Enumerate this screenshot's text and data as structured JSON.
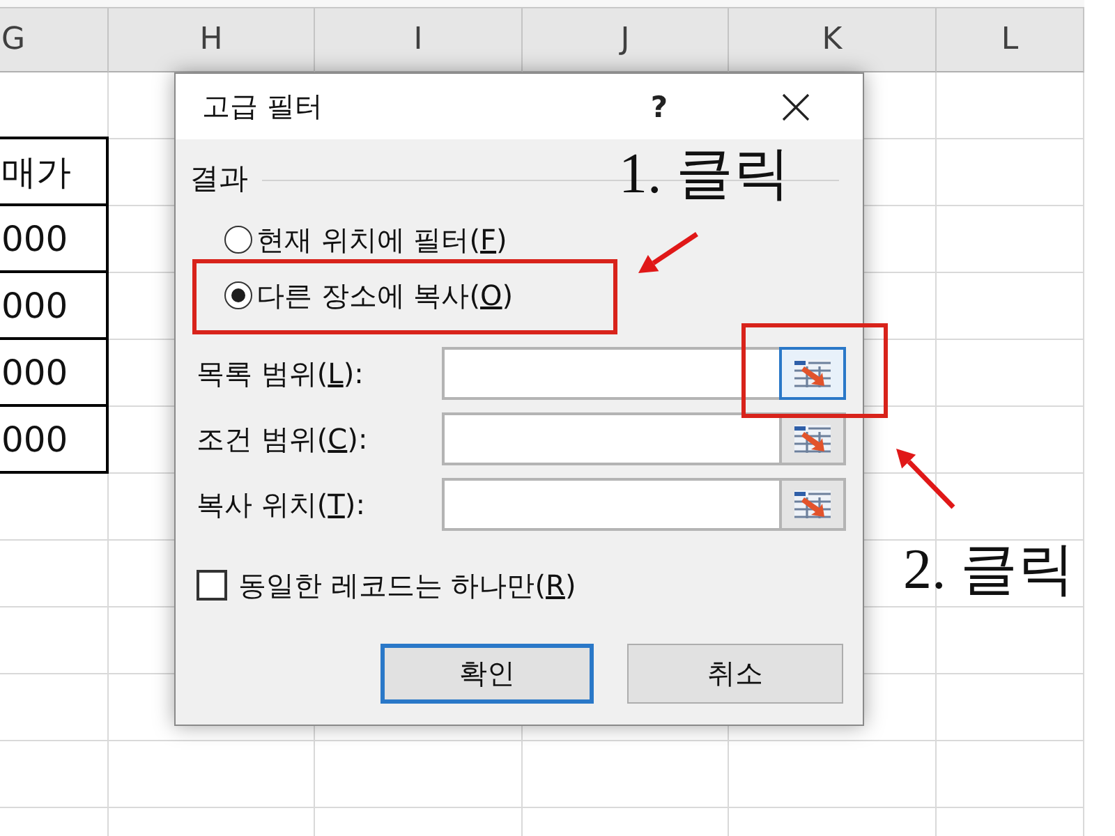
{
  "sheet": {
    "columns": [
      "G",
      "H",
      "I",
      "J",
      "K",
      "L"
    ],
    "cells": [
      "매가",
      "000",
      "000",
      "000",
      "000"
    ]
  },
  "dialog": {
    "title": "고급 필터",
    "help": "?",
    "group_label": "결과",
    "options": [
      {
        "before": "현재 위치에 필터(",
        "key": "F",
        "after": ")",
        "selected": false
      },
      {
        "before": "다른 장소에 복사(",
        "key": "O",
        "after": ")",
        "selected": true
      }
    ],
    "ranges": [
      {
        "before": "목록 범위(",
        "key": "L",
        "after": "):",
        "focused": true
      },
      {
        "before": "조건 범위(",
        "key": "C",
        "after": "):",
        "focused": false
      },
      {
        "before": "복사 위치(",
        "key": "T",
        "after": "):",
        "focused": false
      }
    ],
    "unique_records": {
      "before": "동일한 레코드는 하나만(",
      "key": "R",
      "after": ")",
      "checked": false
    },
    "buttons": [
      {
        "label": "확인",
        "default": true
      },
      {
        "label": "취소",
        "default": false
      }
    ]
  },
  "annotations": [
    {
      "label": "1. 클릭"
    },
    {
      "label": "2. 클릭"
    }
  ]
}
